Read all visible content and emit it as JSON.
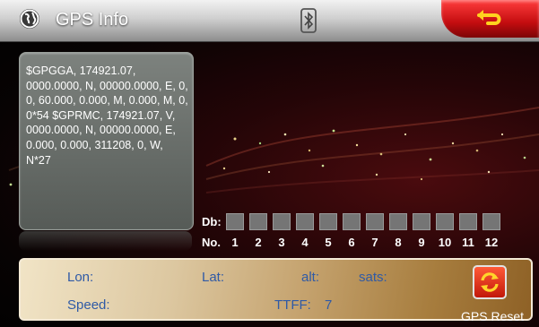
{
  "header": {
    "title": "GPS Info",
    "globe_icon": "globe-icon",
    "bluetooth_icon": "bluetooth-phone-icon",
    "back_icon": "back-arrow-icon"
  },
  "nmea": {
    "text": "$GPGGA, 174921.07, 0000.0000, N, 00000.0000, E, 0, 0, 60.000, 0.000, M, 0.000, M, 0, 0*54 $GPRMC, 174921.07, V, 0000.0000, N, 00000.0000, E, 0.000, 0.000, 311208, 0, W, N*27"
  },
  "signal": {
    "db_label": "Db:",
    "no_label": "No.",
    "satellites": [
      "1",
      "2",
      "3",
      "4",
      "5",
      "6",
      "7",
      "8",
      "9",
      "10",
      "11",
      "12"
    ]
  },
  "info": {
    "lon_label": "Lon:",
    "lat_label": "Lat:",
    "alt_label": "alt:",
    "sats_label": "sats:",
    "speed_label": "Speed:",
    "ttff_label": "TTFF:",
    "ttff_value": "7"
  },
  "reset": {
    "label": "GPS Reset",
    "icon": "refresh-icon"
  },
  "colors": {
    "accent_red": "#c40d10",
    "label_blue": "#2f5aa6"
  }
}
